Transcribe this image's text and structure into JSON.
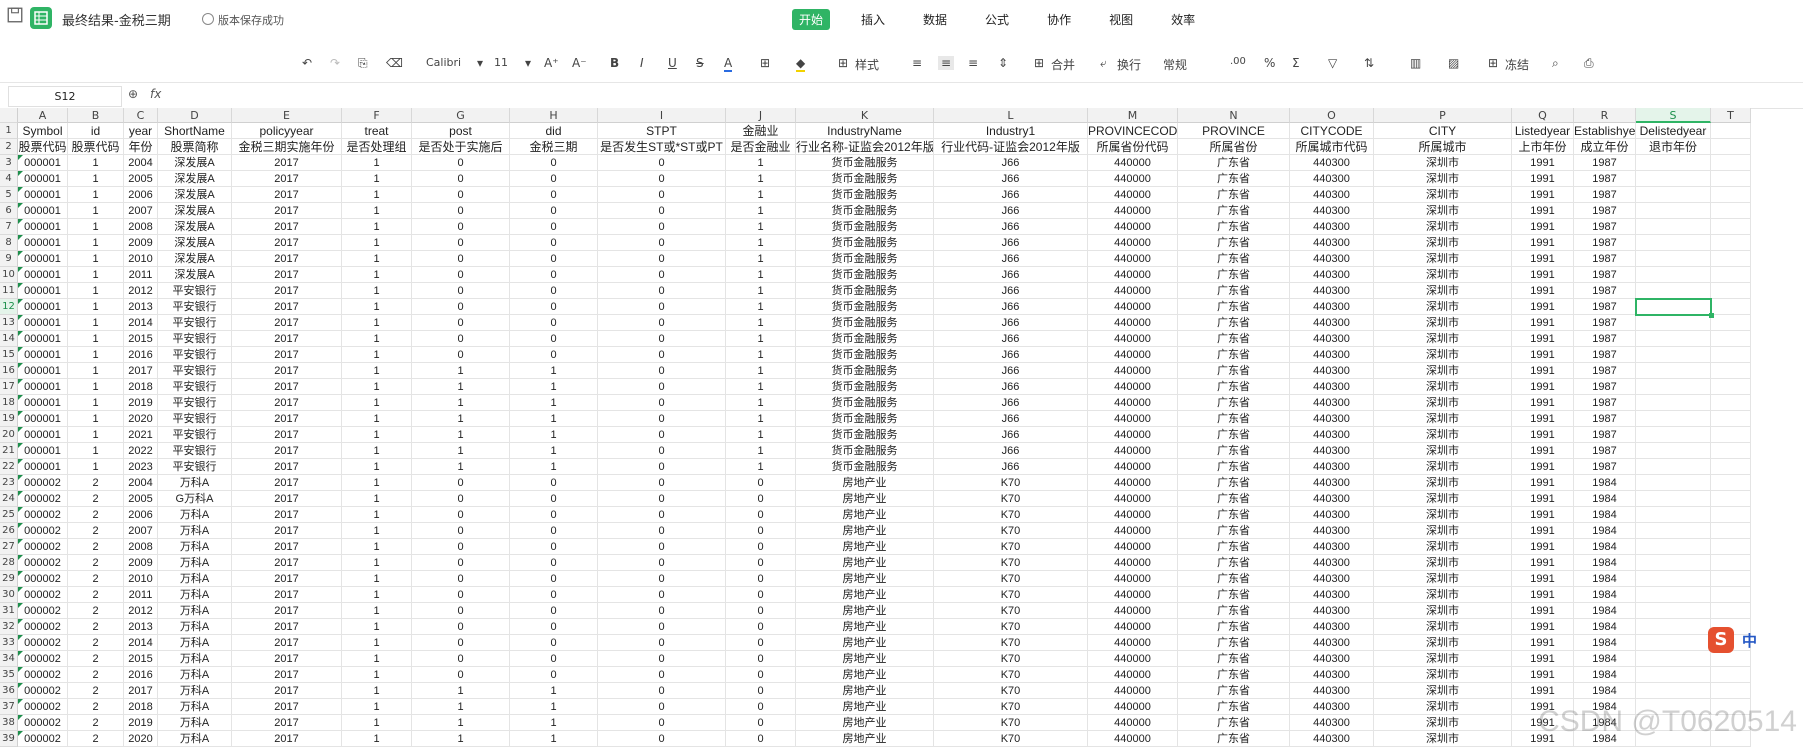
{
  "titlebar": {
    "doc_title": "最终结果-金税三期",
    "save_status": "版本保存成功"
  },
  "menu": [
    "开始",
    "插入",
    "数据",
    "公式",
    "协作",
    "视图",
    "效率"
  ],
  "toolbar": {
    "font_name": "Calibri",
    "font_size": "11",
    "style_label": "样式",
    "merge_label": "合并",
    "wrap_label": "换行",
    "number_format": "常规",
    "freeze_label": "冻结"
  },
  "formula_bar": {
    "name_box": "S12",
    "fx": "fx"
  },
  "columns": [
    "A",
    "B",
    "C",
    "D",
    "E",
    "F",
    "G",
    "H",
    "I",
    "J",
    "K",
    "L",
    "M",
    "N",
    "O",
    "P",
    "Q",
    "R",
    "S",
    "T"
  ],
  "header_row1": [
    "Symbol",
    "id",
    "year",
    "ShortName",
    "policyyear",
    "treat",
    "post",
    "did",
    "STPT",
    "金融业",
    "IndustryName",
    "Industry1",
    "PROVINCECODE",
    "PROVINCE",
    "CITYCODE",
    "CITY",
    "Listedyear",
    "Establishyear",
    "Delistedyear",
    ""
  ],
  "header_row2": [
    "股票代码",
    "股票代码",
    "年份",
    "股票简称",
    "金税三期实施年份",
    "是否处理组",
    "是否处于实施后",
    "金税三期",
    "是否发生ST或*ST或PT",
    "是否金融业",
    "行业名称-证监会2012年版",
    "行业代码-证监会2012年版",
    "所属省份代码",
    "所属省份",
    "所属城市代码",
    "所属城市",
    "上市年份",
    "成立年份",
    "退市年份",
    ""
  ],
  "rows": [
    [
      "000001",
      "1",
      "2004",
      "深发展A",
      "2017",
      "1",
      "0",
      "0",
      "0",
      "1",
      "货币金融服务",
      "J66",
      "440000",
      "广东省",
      "440300",
      "深圳市",
      "1991",
      "1987",
      "",
      ""
    ],
    [
      "000001",
      "1",
      "2005",
      "深发展A",
      "2017",
      "1",
      "0",
      "0",
      "0",
      "1",
      "货币金融服务",
      "J66",
      "440000",
      "广东省",
      "440300",
      "深圳市",
      "1991",
      "1987",
      "",
      ""
    ],
    [
      "000001",
      "1",
      "2006",
      "深发展A",
      "2017",
      "1",
      "0",
      "0",
      "0",
      "1",
      "货币金融服务",
      "J66",
      "440000",
      "广东省",
      "440300",
      "深圳市",
      "1991",
      "1987",
      "",
      ""
    ],
    [
      "000001",
      "1",
      "2007",
      "深发展A",
      "2017",
      "1",
      "0",
      "0",
      "0",
      "1",
      "货币金融服务",
      "J66",
      "440000",
      "广东省",
      "440300",
      "深圳市",
      "1991",
      "1987",
      "",
      ""
    ],
    [
      "000001",
      "1",
      "2008",
      "深发展A",
      "2017",
      "1",
      "0",
      "0",
      "0",
      "1",
      "货币金融服务",
      "J66",
      "440000",
      "广东省",
      "440300",
      "深圳市",
      "1991",
      "1987",
      "",
      ""
    ],
    [
      "000001",
      "1",
      "2009",
      "深发展A",
      "2017",
      "1",
      "0",
      "0",
      "0",
      "1",
      "货币金融服务",
      "J66",
      "440000",
      "广东省",
      "440300",
      "深圳市",
      "1991",
      "1987",
      "",
      ""
    ],
    [
      "000001",
      "1",
      "2010",
      "深发展A",
      "2017",
      "1",
      "0",
      "0",
      "0",
      "1",
      "货币金融服务",
      "J66",
      "440000",
      "广东省",
      "440300",
      "深圳市",
      "1991",
      "1987",
      "",
      ""
    ],
    [
      "000001",
      "1",
      "2011",
      "深发展A",
      "2017",
      "1",
      "0",
      "0",
      "0",
      "1",
      "货币金融服务",
      "J66",
      "440000",
      "广东省",
      "440300",
      "深圳市",
      "1991",
      "1987",
      "",
      ""
    ],
    [
      "000001",
      "1",
      "2012",
      "平安银行",
      "2017",
      "1",
      "0",
      "0",
      "0",
      "1",
      "货币金融服务",
      "J66",
      "440000",
      "广东省",
      "440300",
      "深圳市",
      "1991",
      "1987",
      "",
      ""
    ],
    [
      "000001",
      "1",
      "2013",
      "平安银行",
      "2017",
      "1",
      "0",
      "0",
      "0",
      "1",
      "货币金融服务",
      "J66",
      "440000",
      "广东省",
      "440300",
      "深圳市",
      "1991",
      "1987",
      "",
      ""
    ],
    [
      "000001",
      "1",
      "2014",
      "平安银行",
      "2017",
      "1",
      "0",
      "0",
      "0",
      "1",
      "货币金融服务",
      "J66",
      "440000",
      "广东省",
      "440300",
      "深圳市",
      "1991",
      "1987",
      "",
      ""
    ],
    [
      "000001",
      "1",
      "2015",
      "平安银行",
      "2017",
      "1",
      "0",
      "0",
      "0",
      "1",
      "货币金融服务",
      "J66",
      "440000",
      "广东省",
      "440300",
      "深圳市",
      "1991",
      "1987",
      "",
      ""
    ],
    [
      "000001",
      "1",
      "2016",
      "平安银行",
      "2017",
      "1",
      "0",
      "0",
      "0",
      "1",
      "货币金融服务",
      "J66",
      "440000",
      "广东省",
      "440300",
      "深圳市",
      "1991",
      "1987",
      "",
      ""
    ],
    [
      "000001",
      "1",
      "2017",
      "平安银行",
      "2017",
      "1",
      "1",
      "1",
      "0",
      "1",
      "货币金融服务",
      "J66",
      "440000",
      "广东省",
      "440300",
      "深圳市",
      "1991",
      "1987",
      "",
      ""
    ],
    [
      "000001",
      "1",
      "2018",
      "平安银行",
      "2017",
      "1",
      "1",
      "1",
      "0",
      "1",
      "货币金融服务",
      "J66",
      "440000",
      "广东省",
      "440300",
      "深圳市",
      "1991",
      "1987",
      "",
      ""
    ],
    [
      "000001",
      "1",
      "2019",
      "平安银行",
      "2017",
      "1",
      "1",
      "1",
      "0",
      "1",
      "货币金融服务",
      "J66",
      "440000",
      "广东省",
      "440300",
      "深圳市",
      "1991",
      "1987",
      "",
      ""
    ],
    [
      "000001",
      "1",
      "2020",
      "平安银行",
      "2017",
      "1",
      "1",
      "1",
      "0",
      "1",
      "货币金融服务",
      "J66",
      "440000",
      "广东省",
      "440300",
      "深圳市",
      "1991",
      "1987",
      "",
      ""
    ],
    [
      "000001",
      "1",
      "2021",
      "平安银行",
      "2017",
      "1",
      "1",
      "1",
      "0",
      "1",
      "货币金融服务",
      "J66",
      "440000",
      "广东省",
      "440300",
      "深圳市",
      "1991",
      "1987",
      "",
      ""
    ],
    [
      "000001",
      "1",
      "2022",
      "平安银行",
      "2017",
      "1",
      "1",
      "1",
      "0",
      "1",
      "货币金融服务",
      "J66",
      "440000",
      "广东省",
      "440300",
      "深圳市",
      "1991",
      "1987",
      "",
      ""
    ],
    [
      "000001",
      "1",
      "2023",
      "平安银行",
      "2017",
      "1",
      "1",
      "1",
      "0",
      "1",
      "货币金融服务",
      "J66",
      "440000",
      "广东省",
      "440300",
      "深圳市",
      "1991",
      "1987",
      "",
      ""
    ],
    [
      "000002",
      "2",
      "2004",
      "万科A",
      "2017",
      "1",
      "0",
      "0",
      "0",
      "0",
      "房地产业",
      "K70",
      "440000",
      "广东省",
      "440300",
      "深圳市",
      "1991",
      "1984",
      "",
      ""
    ],
    [
      "000002",
      "2",
      "2005",
      "G万科A",
      "2017",
      "1",
      "0",
      "0",
      "0",
      "0",
      "房地产业",
      "K70",
      "440000",
      "广东省",
      "440300",
      "深圳市",
      "1991",
      "1984",
      "",
      ""
    ],
    [
      "000002",
      "2",
      "2006",
      "万科A",
      "2017",
      "1",
      "0",
      "0",
      "0",
      "0",
      "房地产业",
      "K70",
      "440000",
      "广东省",
      "440300",
      "深圳市",
      "1991",
      "1984",
      "",
      ""
    ],
    [
      "000002",
      "2",
      "2007",
      "万科A",
      "2017",
      "1",
      "0",
      "0",
      "0",
      "0",
      "房地产业",
      "K70",
      "440000",
      "广东省",
      "440300",
      "深圳市",
      "1991",
      "1984",
      "",
      ""
    ],
    [
      "000002",
      "2",
      "2008",
      "万科A",
      "2017",
      "1",
      "0",
      "0",
      "0",
      "0",
      "房地产业",
      "K70",
      "440000",
      "广东省",
      "440300",
      "深圳市",
      "1991",
      "1984",
      "",
      ""
    ],
    [
      "000002",
      "2",
      "2009",
      "万科A",
      "2017",
      "1",
      "0",
      "0",
      "0",
      "0",
      "房地产业",
      "K70",
      "440000",
      "广东省",
      "440300",
      "深圳市",
      "1991",
      "1984",
      "",
      ""
    ],
    [
      "000002",
      "2",
      "2010",
      "万科A",
      "2017",
      "1",
      "0",
      "0",
      "0",
      "0",
      "房地产业",
      "K70",
      "440000",
      "广东省",
      "440300",
      "深圳市",
      "1991",
      "1984",
      "",
      ""
    ],
    [
      "000002",
      "2",
      "2011",
      "万科A",
      "2017",
      "1",
      "0",
      "0",
      "0",
      "0",
      "房地产业",
      "K70",
      "440000",
      "广东省",
      "440300",
      "深圳市",
      "1991",
      "1984",
      "",
      ""
    ],
    [
      "000002",
      "2",
      "2012",
      "万科A",
      "2017",
      "1",
      "0",
      "0",
      "0",
      "0",
      "房地产业",
      "K70",
      "440000",
      "广东省",
      "440300",
      "深圳市",
      "1991",
      "1984",
      "",
      ""
    ],
    [
      "000002",
      "2",
      "2013",
      "万科A",
      "2017",
      "1",
      "0",
      "0",
      "0",
      "0",
      "房地产业",
      "K70",
      "440000",
      "广东省",
      "440300",
      "深圳市",
      "1991",
      "1984",
      "",
      ""
    ],
    [
      "000002",
      "2",
      "2014",
      "万科A",
      "2017",
      "1",
      "0",
      "0",
      "0",
      "0",
      "房地产业",
      "K70",
      "440000",
      "广东省",
      "440300",
      "深圳市",
      "1991",
      "1984",
      "",
      ""
    ],
    [
      "000002",
      "2",
      "2015",
      "万科A",
      "2017",
      "1",
      "0",
      "0",
      "0",
      "0",
      "房地产业",
      "K70",
      "440000",
      "广东省",
      "440300",
      "深圳市",
      "1991",
      "1984",
      "",
      ""
    ],
    [
      "000002",
      "2",
      "2016",
      "万科A",
      "2017",
      "1",
      "0",
      "0",
      "0",
      "0",
      "房地产业",
      "K70",
      "440000",
      "广东省",
      "440300",
      "深圳市",
      "1991",
      "1984",
      "",
      ""
    ],
    [
      "000002",
      "2",
      "2017",
      "万科A",
      "2017",
      "1",
      "1",
      "1",
      "0",
      "0",
      "房地产业",
      "K70",
      "440000",
      "广东省",
      "440300",
      "深圳市",
      "1991",
      "1984",
      "",
      ""
    ],
    [
      "000002",
      "2",
      "2018",
      "万科A",
      "2017",
      "1",
      "1",
      "1",
      "0",
      "0",
      "房地产业",
      "K70",
      "440000",
      "广东省",
      "440300",
      "深圳市",
      "1991",
      "1984",
      "",
      ""
    ],
    [
      "000002",
      "2",
      "2019",
      "万科A",
      "2017",
      "1",
      "1",
      "1",
      "0",
      "0",
      "房地产业",
      "K70",
      "440000",
      "广东省",
      "440300",
      "深圳市",
      "1991",
      "1984",
      "",
      ""
    ],
    [
      "000002",
      "2",
      "2020",
      "万科A",
      "2017",
      "1",
      "1",
      "1",
      "0",
      "0",
      "房地产业",
      "K70",
      "440000",
      "广东省",
      "440300",
      "深圳市",
      "1991",
      "1984",
      "",
      ""
    ]
  ],
  "selected_cell": {
    "column": "S",
    "row": "12"
  },
  "ime": {
    "logo": "S",
    "mode": "中"
  },
  "watermark": "CSDN @T0620514"
}
